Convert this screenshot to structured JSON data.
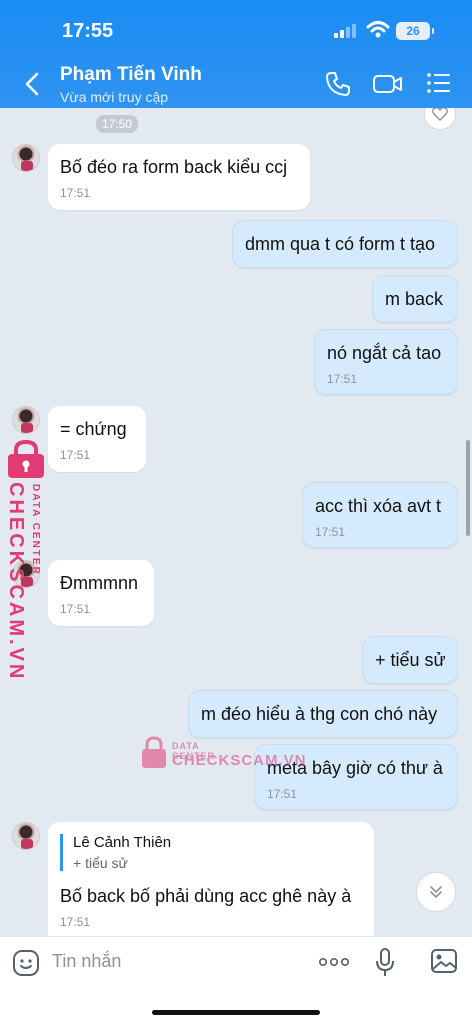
{
  "status_bar": {
    "time": "17:55",
    "battery": "26"
  },
  "header": {
    "name": "Phạm Tiến Vinh",
    "status": "Vừa mới truy cập"
  },
  "chat": {
    "time_separator": "17:50",
    "messages": [
      {
        "side": "in",
        "text": "Bố đéo ra form back kiểu ccj",
        "time": "17:51"
      },
      {
        "side": "out",
        "text": "dmm qua t có form t tạo"
      },
      {
        "side": "out",
        "text": "m back"
      },
      {
        "side": "out",
        "text": "nó ngắt cả tao",
        "time": "17:51"
      },
      {
        "side": "in",
        "text": "= chứng",
        "time": "17:51"
      },
      {
        "side": "out",
        "text": "acc thì xóa avt t",
        "time": "17:51"
      },
      {
        "side": "in",
        "text": "Đmmmnn",
        "time": "17:51"
      },
      {
        "side": "out",
        "text": "+ tiểu sử"
      },
      {
        "side": "out",
        "text": "m đéo hiểu à thg con chó này"
      },
      {
        "side": "out",
        "text": "meta bây giờ có thư à",
        "time": "17:51"
      },
      {
        "side": "in",
        "quote_name": "Lê Cảnh Thiên",
        "quote_text": "+ tiểu sử",
        "text": "Bố back bố phải dùng acc ghê này à",
        "time": "17:51"
      }
    ]
  },
  "watermark": {
    "small": "DATA CENTER",
    "large": "CHECKSCAM.VN"
  },
  "input": {
    "placeholder": "Tin nhắn"
  },
  "colors": {
    "header": "#1a8cf4",
    "outgoing_bubble": "#d5ebfd",
    "incoming_bubble": "#ffffff",
    "chat_bg": "#e2e9f1",
    "watermark": "#e23a73"
  }
}
